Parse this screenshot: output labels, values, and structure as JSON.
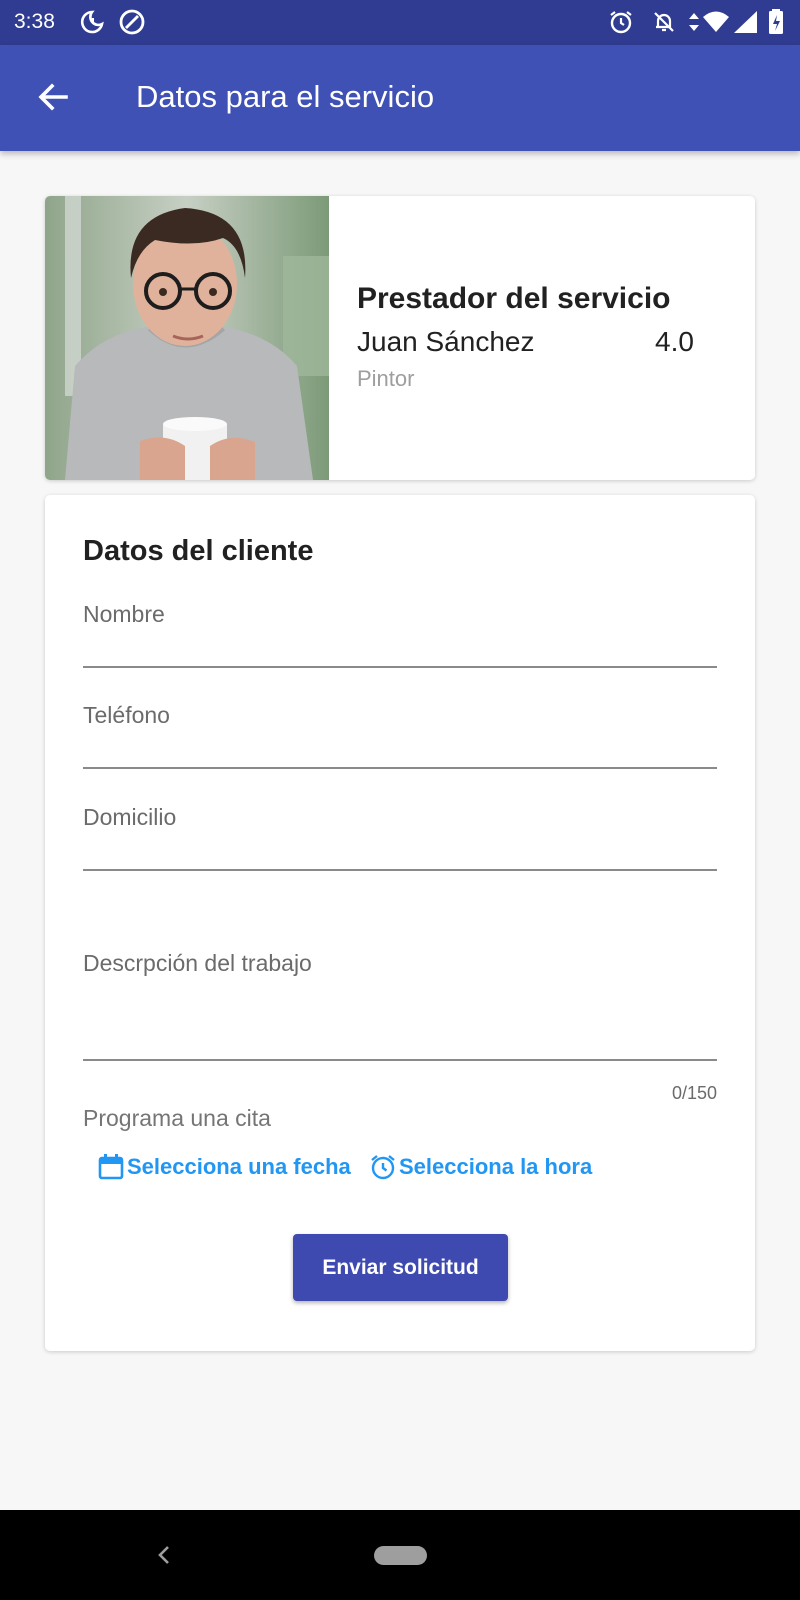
{
  "status_bar": {
    "time": "3:38",
    "icons": [
      "moon-clock-icon",
      "no-disturb-icon",
      "alarm-icon",
      "notifications-off-icon",
      "data-arrows-icon",
      "wifi-icon",
      "signal-icon",
      "battery-icon"
    ]
  },
  "app_bar": {
    "title": "Datos para el servicio",
    "back_icon": "arrow-back-icon"
  },
  "provider": {
    "heading": "Prestador del servicio",
    "name": "Juan Sánchez",
    "rating": "4.0",
    "occupation": "Pintor"
  },
  "client_form": {
    "heading": "Datos del cliente",
    "name_label": "Nombre",
    "phone_label": "Teléfono",
    "address_label": "Domicilio",
    "description_label": "Descrpción del trabajo",
    "description_counter": "0/150",
    "appointment_label": "Programa una cita",
    "date_button": "Selecciona una fecha",
    "time_button": "Selecciona la hora",
    "submit_button": "Enviar solicitud"
  },
  "colors": {
    "status_bar": "#2f3c91",
    "app_bar": "#3f51b5",
    "accent": "#2196f3",
    "button": "#3f4ab1"
  }
}
